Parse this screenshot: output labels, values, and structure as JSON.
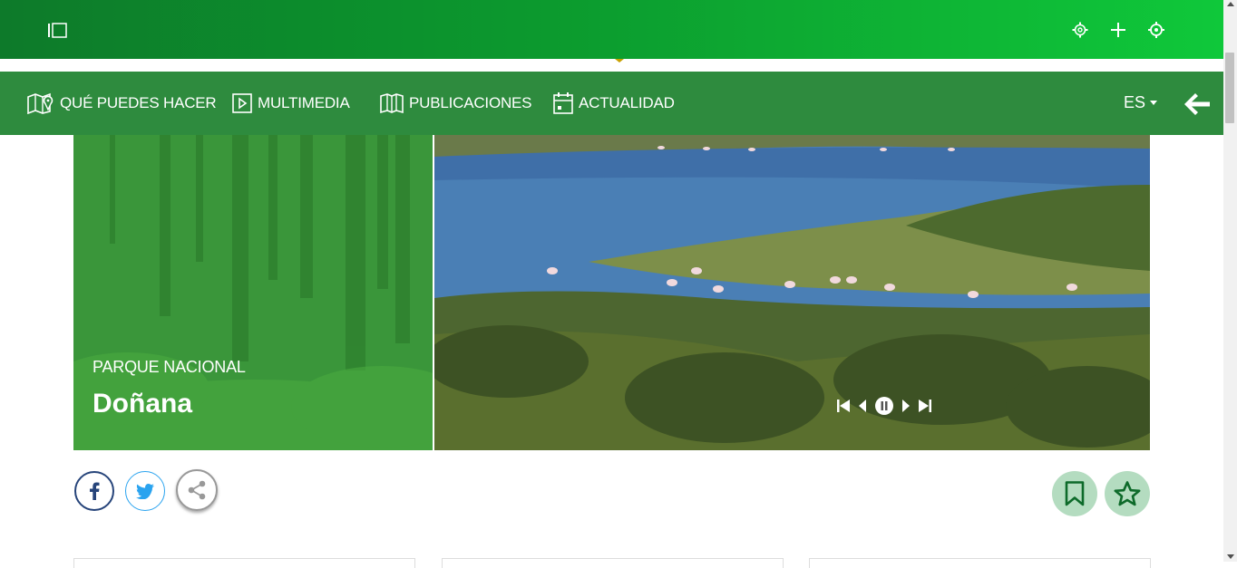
{
  "topbar": {
    "icons": [
      "sidebar-toggle-icon",
      "settings-icon",
      "plus-icon",
      "target-icon"
    ]
  },
  "nav": {
    "items": [
      {
        "label": "QUÉ PUEDES HACER",
        "icon": "map-pin-icon"
      },
      {
        "label": "MULTIMEDIA",
        "icon": "play-icon"
      },
      {
        "label": "PUBLICACIONES",
        "icon": "book-icon"
      },
      {
        "label": "ACTUALIDAD",
        "icon": "calendar-icon"
      }
    ],
    "language": "ES",
    "back_icon": "arrow-left-icon"
  },
  "hero": {
    "kicker": "PARQUE NACIONAL",
    "title": "Doñana",
    "slideshow_controls": [
      "first-icon",
      "prev-icon",
      "pause-icon",
      "next-icon",
      "last-icon"
    ]
  },
  "share": [
    "facebook-icon",
    "twitter-icon",
    "share-icon"
  ],
  "actions": [
    "bookmark-icon",
    "star-icon"
  ],
  "colors": {
    "nav_green": "#2e8b3e",
    "topbar_start": "#0d7a2a",
    "topbar_end": "#0fc83a",
    "action_bg": "#b4dcc0",
    "facebook": "#26447a",
    "twitter": "#2aa3ef"
  }
}
